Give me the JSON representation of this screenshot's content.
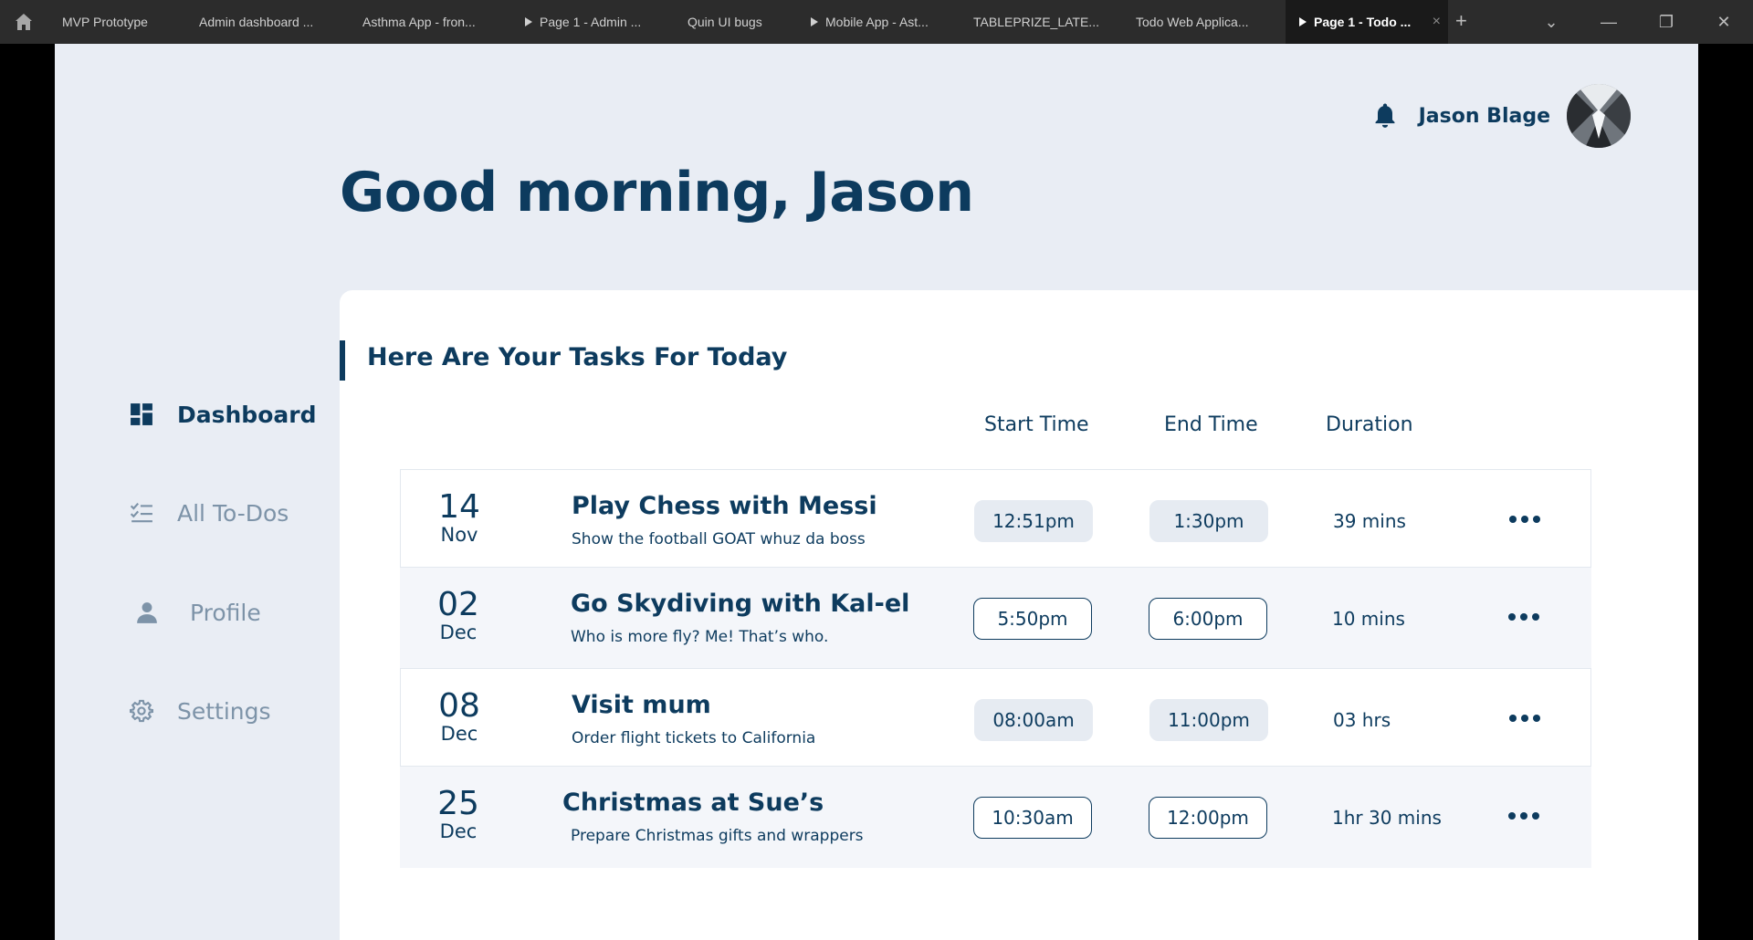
{
  "browser": {
    "tabs": [
      {
        "label": "MVP Prototype",
        "playable": false
      },
      {
        "label": "Admin dashboard ...",
        "playable": false
      },
      {
        "label": "Asthma App - fron...",
        "playable": false
      },
      {
        "label": "Page 1 - Admin ...",
        "playable": true
      },
      {
        "label": "Quin UI bugs",
        "playable": false
      },
      {
        "label": "Mobile App - Ast...",
        "playable": true
      },
      {
        "label": "TABLEPRIZE_LATE...",
        "playable": false
      },
      {
        "label": "Todo Web Applica...",
        "playable": false
      },
      {
        "label": "Page 1 - Todo ...",
        "playable": true,
        "active": true
      }
    ],
    "new_tab": "+",
    "tab_close": "×",
    "controls": {
      "dropdown": "⌄",
      "minimize": "—",
      "restore": "❐",
      "close": "✕"
    }
  },
  "header": {
    "user_name": "Jason Blage",
    "greeting": "Good morning, Jason"
  },
  "sidebar": {
    "items": [
      {
        "label": "Dashboard",
        "icon": "dashboard-icon",
        "active": true
      },
      {
        "label": "All To-Dos",
        "icon": "checklist-icon",
        "active": false
      },
      {
        "label": "Profile",
        "icon": "person-icon",
        "active": false
      },
      {
        "label": "Settings",
        "icon": "gear-icon",
        "active": false
      }
    ]
  },
  "tasks": {
    "title": "Here Are Your Tasks For Today",
    "columns": {
      "start": "Start Time",
      "end": "End Time",
      "duration": "Duration"
    },
    "rows": [
      {
        "day": "14",
        "month": "Nov",
        "title": "Play Chess with Messi",
        "subtitle": "Show the football GOAT whuz da boss",
        "start": "12:51pm",
        "end": "1:30pm",
        "duration": "39 mins",
        "pill_style": "filled"
      },
      {
        "day": "02",
        "month": "Dec",
        "title": "Go Skydiving with Kal-el",
        "subtitle": "Who is more fly? Me! That’s who.",
        "start": "5:50pm",
        "end": "6:00pm",
        "duration": "10 mins",
        "pill_style": "outline"
      },
      {
        "day": "08",
        "month": "Dec",
        "title": "Visit mum",
        "subtitle": "Order flight tickets to California",
        "start": "08:00am",
        "end": "11:00pm",
        "duration": "03 hrs",
        "pill_style": "filled"
      },
      {
        "day": "25",
        "month": "Dec",
        "title": "Christmas at Sue’s",
        "subtitle": "Prepare Christmas gifts and wrappers",
        "start": "10:30am",
        "end": "12:00pm",
        "duration": "1hr 30 mins",
        "pill_style": "outline"
      }
    ]
  },
  "colors": {
    "primary": "#0d3b5e",
    "muted_nav": "#7d93a8",
    "background": "#e9edf4",
    "card": "#ffffff",
    "pill_fill": "#e6ebf2"
  }
}
